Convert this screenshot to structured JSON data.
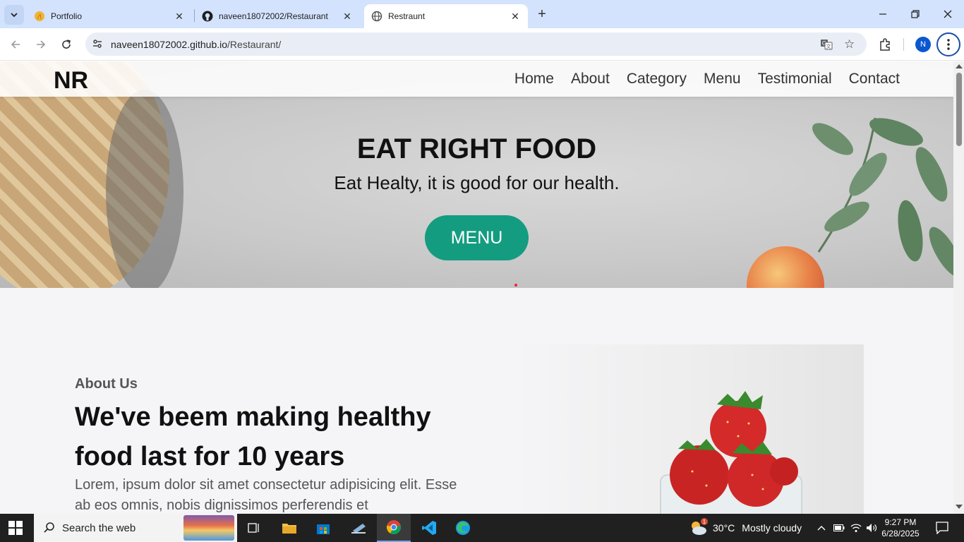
{
  "browser": {
    "tabs": [
      {
        "label": "Portfolio",
        "active": false
      },
      {
        "label": "naveen18072002/Restaurant",
        "active": false
      },
      {
        "label": "Restraunt",
        "active": true
      }
    ],
    "url_host": "naveen18072002.github.io",
    "url_path": "/Restaurant/",
    "profile_initial": "N"
  },
  "site": {
    "logo": "NR",
    "nav": [
      "Home",
      "About",
      "Category",
      "Menu",
      "Testimonial",
      "Contact"
    ],
    "hero": {
      "title": "EAT RIGHT FOOD",
      "subtitle": "Eat Healty, it is good for our health.",
      "button": "MENU"
    },
    "about": {
      "kicker": "About Us",
      "title": "We've beem making healthy food last for 10 years",
      "text": "Lorem, ipsum dolor sit amet consectetur adipisicing elit. Esse ab eos omnis, nobis dignissimos perferendis et"
    }
  },
  "taskbar": {
    "search_placeholder": "Search the web",
    "weather_temp": "30°C",
    "weather_desc": "Mostly cloudy",
    "time": "9:27 PM",
    "date": "6/28/2025",
    "notification_count": "1"
  },
  "colors": {
    "accent": "#149c80",
    "tabstrip": "#d3e3fd",
    "taskbar": "#202020"
  }
}
